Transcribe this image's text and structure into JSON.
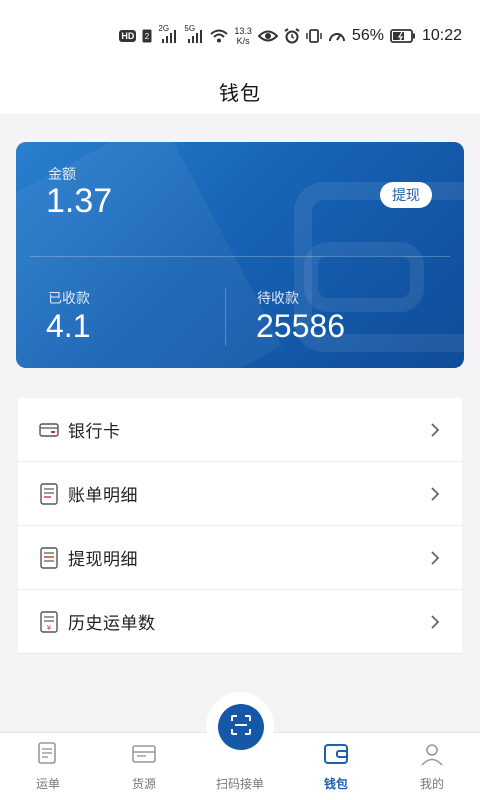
{
  "status_bar": {
    "hd": "HD",
    "sim": "2",
    "net1": "2G",
    "net2": "5G",
    "speed_value": "13.3",
    "speed_unit": "K/s",
    "battery": "56%",
    "time": "10:22"
  },
  "header": {
    "title": "钱包"
  },
  "wallet": {
    "amount_label": "金额",
    "amount_value": "1.37",
    "withdraw_label": "提现",
    "received_label": "已收款",
    "received_value": "4.1",
    "pending_label": "待收款",
    "pending_value": "25586"
  },
  "menu": {
    "items": [
      {
        "label": "银行卡",
        "icon": "bank-card-icon"
      },
      {
        "label": "账单明细",
        "icon": "bill-icon"
      },
      {
        "label": "提现明细",
        "icon": "withdraw-record-icon"
      },
      {
        "label": "历史运单数",
        "icon": "history-waybill-icon"
      }
    ]
  },
  "bottom_nav": {
    "items": [
      {
        "label": "运单",
        "icon": "waybill-icon"
      },
      {
        "label": "货源",
        "icon": "goods-source-icon"
      },
      {
        "label": "扫码接单",
        "icon": "scan-icon"
      },
      {
        "label": "钱包",
        "icon": "wallet-icon"
      },
      {
        "label": "我的",
        "icon": "profile-icon"
      }
    ],
    "active_index": 3
  },
  "colors": {
    "accent": "#1b5fad",
    "card_start": "#2a7fcf",
    "card_end": "#0f4c98",
    "scan_button": "#1658a8"
  }
}
